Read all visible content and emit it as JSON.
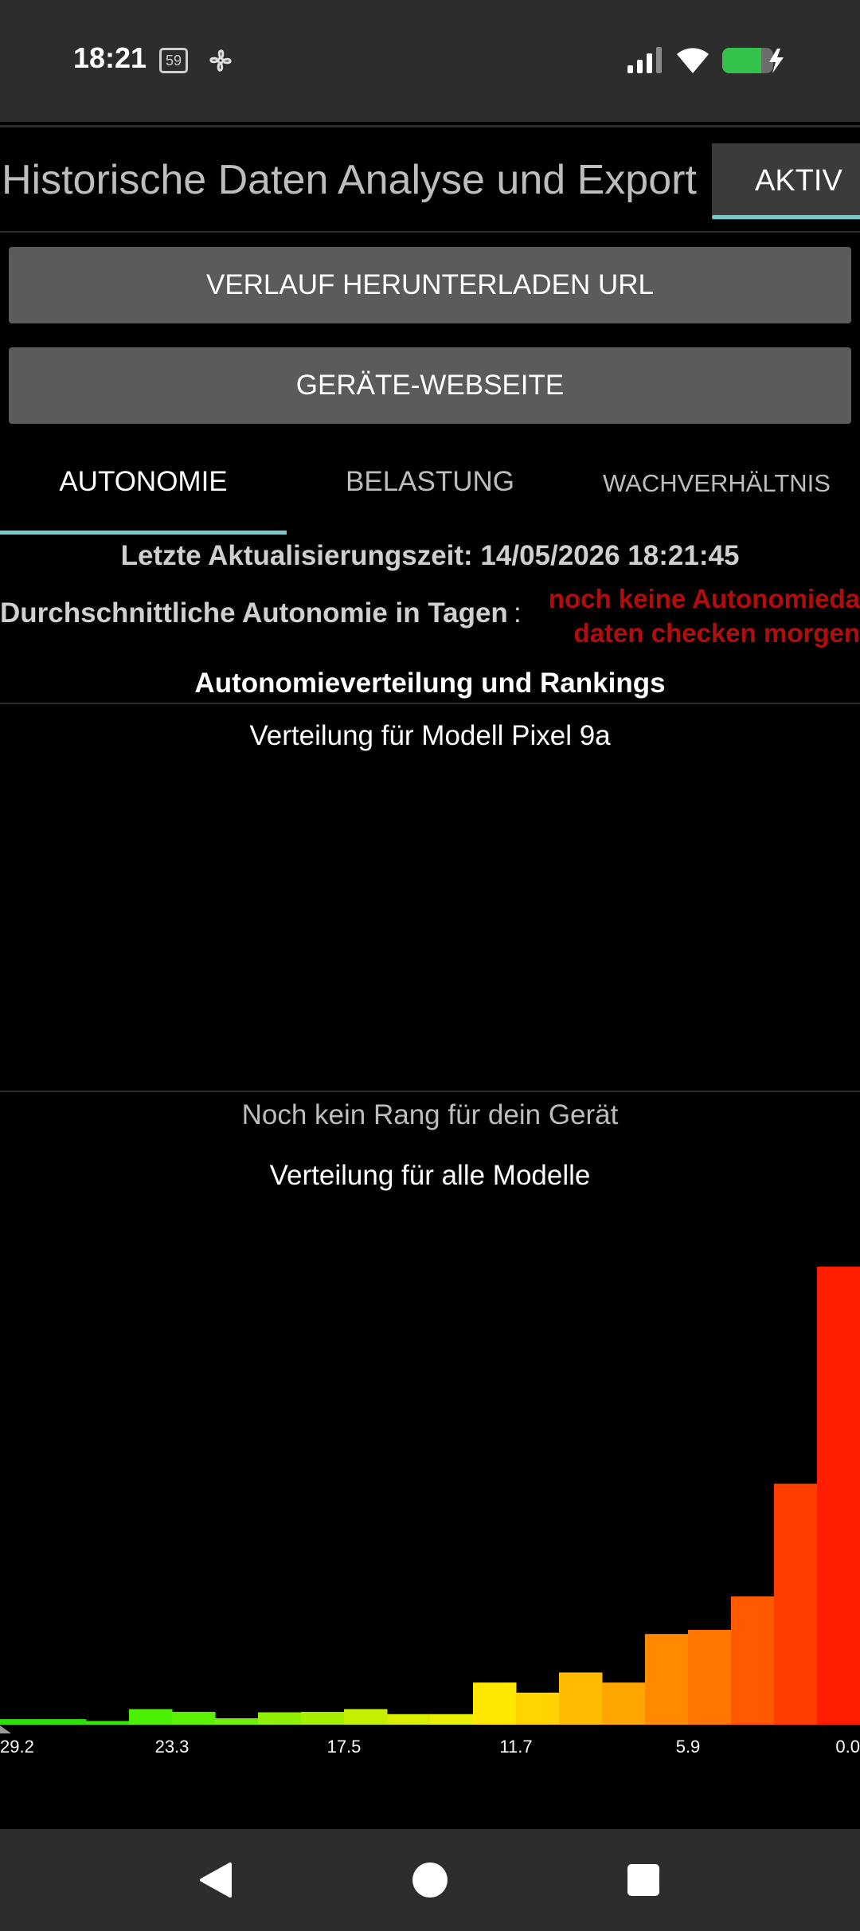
{
  "status_bar": {
    "time": "18:21",
    "calendar_badge": "59",
    "icons": [
      "calendar-icon",
      "fan-icon",
      "signal-icon",
      "wifi-icon",
      "battery-charging-icon"
    ]
  },
  "header": {
    "title": "Historische Daten Analyse und Export",
    "active_tab": "AKTIV"
  },
  "buttons": {
    "download": "VERLAUF HERUNTERLADEN URL",
    "website": "GERÄTE-WEBSEITE"
  },
  "tabs": [
    {
      "label": "AUTONOMIE",
      "selected": true
    },
    {
      "label": "BELASTUNG",
      "selected": false
    },
    {
      "label": "WACHVERHÄLTNIS",
      "selected": false
    }
  ],
  "info": {
    "update_label": "Letzte Aktualisierungszeit: 14/05/2026 18:21:45",
    "avg_label": "Durchschnittliche Autonomie in Tagen",
    "avg_colon": ":",
    "avg_value_line1": "noch keine Autonomieda",
    "avg_value_line2": "daten checken morgen"
  },
  "section": {
    "title": "Autonomieverteilung und Rankings",
    "model_title": "Verteilung für Modell Pixel 9a",
    "no_rank": "Noch kein Rang für dein Gerät",
    "all_title": "Verteilung für alle Modelle"
  },
  "chart_data": {
    "type": "bar",
    "x_tick_labels": [
      "29.2",
      "23.3",
      "17.5",
      "11.7",
      "5.9",
      "0.0"
    ],
    "x_direction": "descending",
    "bins_days": [
      29.2,
      27.7,
      26.3,
      24.8,
      23.3,
      21.9,
      20.4,
      19.0,
      17.5,
      16.1,
      14.6,
      13.1,
      11.7,
      10.2,
      8.8,
      7.3,
      5.9,
      4.4,
      2.9,
      1.5
    ],
    "values": [
      1.2,
      1.2,
      0.8,
      3.4,
      2.8,
      1.4,
      2.7,
      2.8,
      3.4,
      2.3,
      2.3,
      9.2,
      7.0,
      11.4,
      9.2,
      19.8,
      20.7,
      28.0,
      52.6,
      100
    ],
    "colors": [
      "#2ee000",
      "#2ee000",
      "#37e800",
      "#4bf000",
      "#5af000",
      "#6ef000",
      "#90f000",
      "#a4f000",
      "#c4f000",
      "#d8ee00",
      "#e8ee00",
      "#ffe800",
      "#ffd400",
      "#ffbc00",
      "#ffa500",
      "#ff8a00",
      "#ff7600",
      "#ff5a00",
      "#ff3e00",
      "#ff1e00"
    ],
    "y_axis": "relative frequency (unlabeled)",
    "grid": false
  },
  "nav_bar": {
    "icons": [
      "back-icon",
      "home-icon",
      "recent-apps-icon"
    ]
  }
}
